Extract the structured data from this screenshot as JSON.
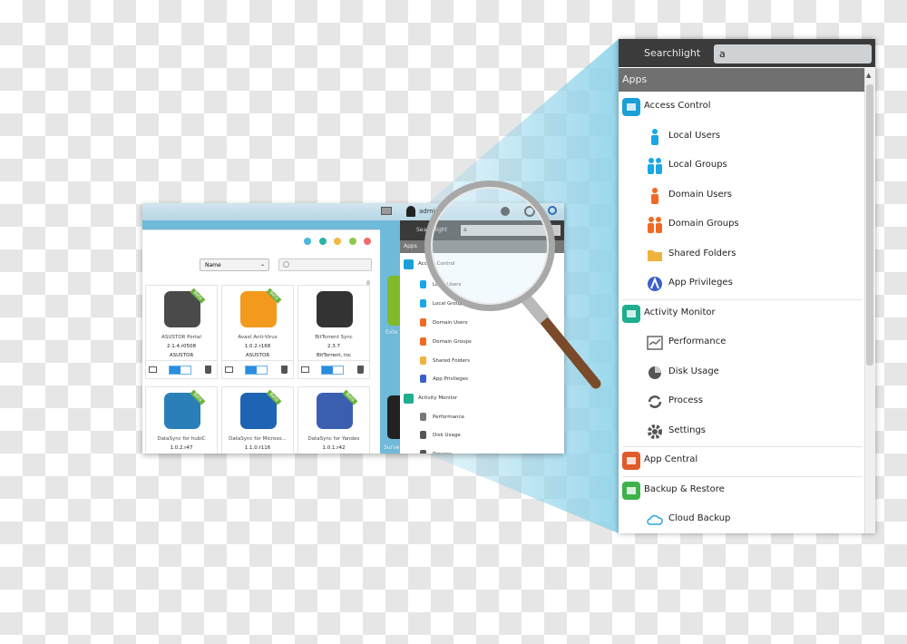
{
  "background": {
    "cone_color": "#8fd3ea"
  },
  "left_window": {
    "topbar": {
      "user": "admin"
    },
    "window_controls_colors": [
      "#49b9de",
      "#2bb3a5",
      "#f2b84a",
      "#8bc94a",
      "#f26d6d"
    ],
    "sort_select": {
      "value": "Name"
    },
    "search": {
      "placeholder": ""
    },
    "apps": [
      {
        "name": "ASUSTOR Portal",
        "version": "2.1.4.r0508",
        "publisher": "ASUSTOR",
        "badge": "Beta",
        "color": "#4a4a4a"
      },
      {
        "name": "Avast Anti-Virus",
        "version": "1.0.2.r168",
        "publisher": "ASUSTOR",
        "badge": "Beta",
        "color": "#f39a1e"
      },
      {
        "name": "BitTorrent Sync",
        "version": "2.3.7",
        "publisher": "BitTorrent, inc",
        "badge": "",
        "color": "#333333"
      },
      {
        "name": "DataSync for hubiC",
        "version": "1.0.2.r47",
        "publisher": "",
        "badge": "Beta",
        "color": "#2a7fb8"
      },
      {
        "name": "DataSync for Microso...",
        "version": "1.1.0.r116",
        "publisher": "",
        "badge": "Beta",
        "color": "#1e63b4"
      },
      {
        "name": "DataSync for Yandex",
        "version": "1.0.1.r42",
        "publisher": "",
        "badge": "Beta",
        "color": "#3b5fb0"
      }
    ],
    "desktop_labels": [
      "Exte",
      "Surve"
    ],
    "searchlight": {
      "title": "Searchlight",
      "query": "a",
      "section": "Apps",
      "items": [
        "Access Control",
        "Local Users",
        "Local Groups",
        "Domain Users",
        "Domain Groups",
        "Shared Folders",
        "App Privileges",
        "Activity Monitor",
        "Performance",
        "Disk Usage",
        "Process"
      ]
    }
  },
  "searchlight": {
    "title": "Searchlight",
    "query": "a",
    "section": "Apps",
    "groups": [
      {
        "label": "Access Control",
        "icon": "access-control-icon",
        "color": "#1a9fd6",
        "children": [
          {
            "label": "Local Users",
            "icon": "user-icon",
            "color": "#1aa7e8"
          },
          {
            "label": "Local Groups",
            "icon": "group-icon",
            "color": "#1aa7e8"
          },
          {
            "label": "Domain Users",
            "icon": "user-icon",
            "color": "#f26a22"
          },
          {
            "label": "Domain Groups",
            "icon": "group-icon",
            "color": "#f26a22"
          },
          {
            "label": "Shared Folders",
            "icon": "folder-icon",
            "color": "#f0b23e"
          },
          {
            "label": "App Privileges",
            "icon": "privileges-icon",
            "color": "#3b5fc9"
          }
        ]
      },
      {
        "label": "Activity Monitor",
        "icon": "activity-monitor-icon",
        "color": "#1fae8f",
        "children": [
          {
            "label": "Performance",
            "icon": "performance-icon",
            "color": "#666666"
          },
          {
            "label": "Disk Usage",
            "icon": "disk-usage-icon",
            "color": "#555555"
          },
          {
            "label": "Process",
            "icon": "process-icon",
            "color": "#555555"
          },
          {
            "label": "Settings",
            "icon": "gear-icon",
            "color": "#555555"
          }
        ]
      },
      {
        "label": "App Central",
        "icon": "app-central-icon",
        "color": "#e05a2a",
        "children": []
      },
      {
        "label": "Backup & Restore",
        "icon": "backup-restore-icon",
        "color": "#3fb14a",
        "children": [
          {
            "label": "Cloud Backup",
            "icon": "cloud-icon",
            "color": "#2aa7e0"
          }
        ]
      }
    ]
  }
}
